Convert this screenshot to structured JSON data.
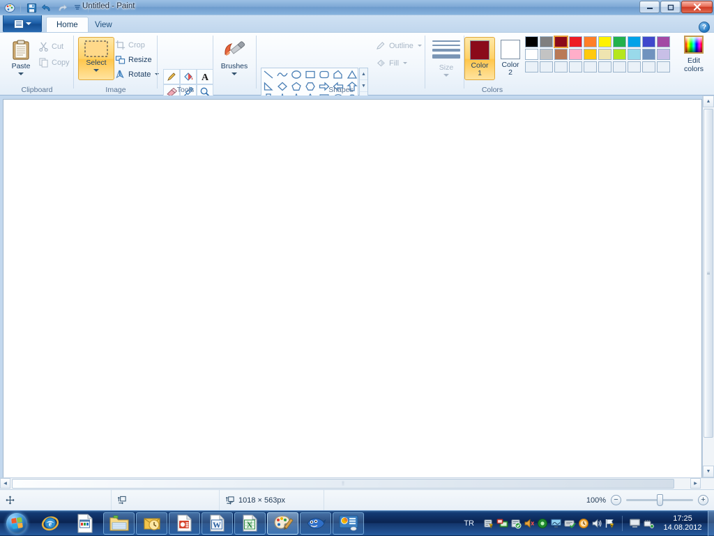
{
  "window": {
    "title": "Untitled - Paint",
    "quick_access": [
      {
        "name": "app-icon",
        "icon": "paint-palette-icon"
      },
      {
        "name": "save",
        "icon": "floppy-disk-icon"
      },
      {
        "name": "undo",
        "icon": "undo-arrow-icon"
      },
      {
        "name": "redo",
        "icon": "redo-arrow-icon"
      },
      {
        "name": "customize-qat",
        "icon": "chevron-down-icon"
      }
    ],
    "controls": {
      "minimize": "—",
      "maximize": "❐",
      "close": "✕"
    },
    "help_label": "?"
  },
  "tabs": [
    {
      "label": "Home",
      "active": true
    },
    {
      "label": "View",
      "active": false
    }
  ],
  "ribbon": {
    "groups": [
      {
        "name": "clipboard",
        "label": "Clipboard",
        "big_button": {
          "label": "Paste",
          "has_arrow": true,
          "icon": "clipboard-icon",
          "disabled": false
        },
        "commands": [
          {
            "label": "Cut",
            "icon": "scissors-icon",
            "disabled": true
          },
          {
            "label": "Copy",
            "icon": "copy-pages-icon",
            "disabled": true
          }
        ]
      },
      {
        "name": "image",
        "label": "Image",
        "big_button": {
          "label": "Select",
          "has_arrow": true,
          "icon": "selection-rectangle-icon",
          "selected": true
        },
        "commands": [
          {
            "label": "Crop",
            "icon": "crop-icon",
            "disabled": true
          },
          {
            "label": "Resize",
            "icon": "resize-icon",
            "disabled": false
          },
          {
            "label": "Rotate",
            "icon": "rotate-icon",
            "disabled": false,
            "has_arrow": true
          }
        ]
      },
      {
        "name": "tools",
        "label": "Tools",
        "tools": [
          {
            "name": "pencil-tool",
            "icon": "pencil-icon"
          },
          {
            "name": "fill-tool",
            "icon": "paint-bucket-icon"
          },
          {
            "name": "text-tool",
            "icon": "letter-a-icon"
          },
          {
            "name": "eraser-tool",
            "icon": "eraser-icon"
          },
          {
            "name": "color-picker-tool",
            "icon": "eyedropper-icon"
          },
          {
            "name": "magnifier-tool",
            "icon": "magnifier-icon"
          }
        ]
      },
      {
        "name": "brushes",
        "label": "",
        "big_button": {
          "label": "Brushes",
          "has_arrow": true,
          "icon": "paintbrush-icon"
        }
      },
      {
        "name": "shapes",
        "label": "Shapes",
        "shapes": [
          "line",
          "curve",
          "oval",
          "rectangle",
          "rounded-rectangle",
          "polygon",
          "triangle",
          "right-triangle",
          "diamond",
          "pentagon",
          "hexagon",
          "right-arrow",
          "left-arrow",
          "up-arrow",
          "down-arrow",
          "four-point-star",
          "five-point-star",
          "six-point-star",
          "rounded-callout",
          "oval-callout",
          "cloud-callout"
        ],
        "gallery_scroll": [
          "▲",
          "▼",
          "▤"
        ],
        "commands": [
          {
            "label": "Outline",
            "icon": "outline-pencil-icon",
            "disabled": true,
            "has_arrow": true
          },
          {
            "label": "Fill",
            "icon": "fill-bucket-icon",
            "disabled": true,
            "has_arrow": true
          }
        ]
      },
      {
        "name": "size",
        "label": "",
        "big_button": {
          "label": "Size",
          "has_arrow": true,
          "icon": "line-thickness-icon",
          "disabled": true
        }
      },
      {
        "name": "colors",
        "label": "Colors",
        "color1": {
          "label_top": "Color",
          "label_bottom": "1",
          "value": "#8b0a1a",
          "selected": true
        },
        "color2": {
          "label_top": "Color",
          "label_bottom": "2",
          "value": "#ffffff",
          "selected": false
        },
        "palette_row1": [
          "#000000",
          "#7f7f7f",
          "#8b0a1a",
          "#ed1c24",
          "#ff7f27",
          "#fff200",
          "#22b14c",
          "#00a2e8",
          "#3f48cc",
          "#a349a4"
        ],
        "palette_row2": [
          "#ffffff",
          "#c3c3c3",
          "#b97a57",
          "#ffaec9",
          "#ffc90e",
          "#efe4b0",
          "#b5e61d",
          "#99d9ea",
          "#7092be",
          "#c8bfe7"
        ],
        "palette_row3": [
          "",
          "",
          "",
          "",
          "",
          "",
          "",
          "",
          "",
          ""
        ],
        "selected_palette_index": 2,
        "edit_colors": {
          "label_line1": "Edit",
          "label_line2": "colors",
          "icon": "color-spectrum-icon"
        }
      }
    ]
  },
  "statusbar": {
    "cursor_position": "",
    "selection_size": "",
    "image_size": "1018 × 563px",
    "cursor_icon": "crosshair-icon",
    "selection_icon": "selection-size-icon",
    "image_icon": "image-size-icon",
    "zoom_level": "100%",
    "zoom_out": "−",
    "zoom_in": "+"
  },
  "scrollbars": {
    "vertical": {
      "up": "▲",
      "down": "▼",
      "grip": "≡"
    },
    "horizontal": {
      "left": "◀",
      "right": "▶",
      "grip": "⦙⦙"
    }
  },
  "taskbar": {
    "start_label": "Start",
    "items": [
      {
        "name": "internet-explorer",
        "icon": "ie-icon",
        "state": "pinned"
      },
      {
        "name": "notepad-document",
        "icon": "document-icon",
        "state": "pinned"
      },
      {
        "name": "windows-explorer",
        "icon": "folder-icon",
        "state": "open"
      },
      {
        "name": "outlook",
        "icon": "outlook-clock-icon",
        "state": "open"
      },
      {
        "name": "powerpoint",
        "icon": "powerpoint-icon",
        "state": "open"
      },
      {
        "name": "word",
        "icon": "word-icon",
        "state": "open"
      },
      {
        "name": "excel",
        "icon": "excel-icon",
        "state": "open"
      },
      {
        "name": "paint",
        "icon": "paint-palette-icon",
        "state": "active"
      },
      {
        "name": "fish-app",
        "icon": "fish-icon",
        "state": "open"
      },
      {
        "name": "dashboard-app",
        "icon": "dashboard-icon",
        "state": "open"
      }
    ],
    "language": "TR",
    "tray_icons": [
      "action-center-warning-icon",
      "network-computer-icon",
      "security-icon",
      "speaker-mute-icon",
      "green-circle-icon",
      "monitor-icon",
      "keyboard-check-icon",
      "orange-clock-icon",
      "speaker-icon",
      "flag-warning-icon"
    ],
    "tray_right_icons": [
      "screen-icon",
      "eject-hardware-icon"
    ],
    "clock_time": "17:25",
    "clock_date": "14.08.2012"
  },
  "colors": {
    "accent": "#1d5fa8",
    "ribbon_bg": "#f2f7fc",
    "canvas": "#ffffff",
    "workarea": "#c3d8ee",
    "taskbar": "#0d2c5c",
    "selected_highlight": "#ffd166"
  }
}
